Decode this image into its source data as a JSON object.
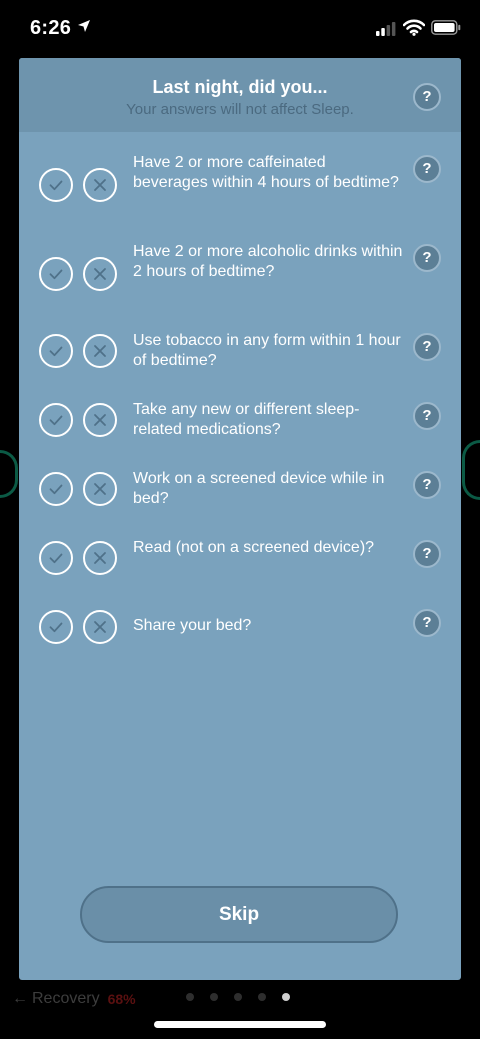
{
  "status_bar": {
    "time": "6:26"
  },
  "modal": {
    "title": "Last night, did you...",
    "subtitle": "Your answers will not affect Sleep.",
    "help_label": "?",
    "questions": [
      {
        "text": "Have 2 or more caffeinated beverages within 4 hours of bedtime?"
      },
      {
        "text": "Have 2 or more alcoholic drinks within 2 hours of bedtime?"
      },
      {
        "text": "Use tobacco in any form within 1 hour of bedtime?"
      },
      {
        "text": "Take any new or different sleep-related medications?"
      },
      {
        "text": "Work on a screened device while in bed?"
      },
      {
        "text": "Read (not on a screened device)?"
      },
      {
        "text": "Share your bed?"
      }
    ],
    "skip_label": "Skip"
  },
  "background": {
    "nav_label": "Recovery",
    "nav_arrow": "←",
    "nav_tag": "68%"
  },
  "colors": {
    "modal_bg": "#7aa2bd",
    "header_bg": "#6e94ad",
    "icon_mark": "#4f7189"
  }
}
